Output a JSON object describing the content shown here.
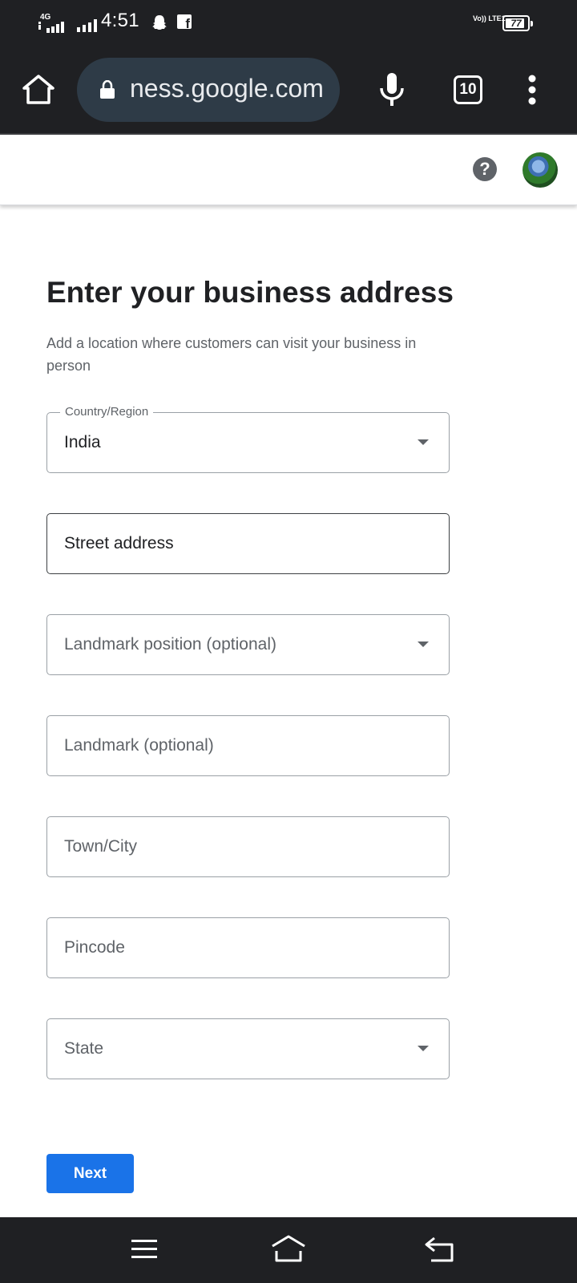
{
  "status_bar": {
    "network": "4G",
    "time": "4:51",
    "volte": "Vo)) LTE1",
    "battery_level": "77",
    "icons": [
      "signal-icon",
      "snapchat-icon",
      "facebook-icon",
      "battery-icon"
    ]
  },
  "browser": {
    "url": "ness.google.com",
    "tab_count": "10",
    "icons": [
      "home-icon",
      "lock-icon",
      "mic-icon",
      "tabs-icon",
      "more-vert-icon"
    ]
  },
  "header": {
    "help_label": "?",
    "icons": [
      "help-icon",
      "avatar"
    ]
  },
  "form": {
    "title": "Enter your business address",
    "subtitle": "Add a location where customers can visit your business in person",
    "country_label": "Country/Region",
    "country_value": "India",
    "street_placeholder": "Street address",
    "landmark_position_placeholder": "Landmark position (optional)",
    "landmark_placeholder": "Landmark (optional)",
    "city_placeholder": "Town/City",
    "pincode_placeholder": "Pincode",
    "state_placeholder": "State",
    "next_label": "Next"
  },
  "nav_bar": {
    "icons": [
      "menu-icon",
      "home-icon",
      "back-icon"
    ]
  },
  "colors": {
    "system_bars": "#1f2023",
    "url_pill": "#2e3b47",
    "primary_button": "#1a73e8",
    "title_text": "#202124",
    "secondary_text": "#5f6368",
    "field_border": "#9aa0a6"
  }
}
